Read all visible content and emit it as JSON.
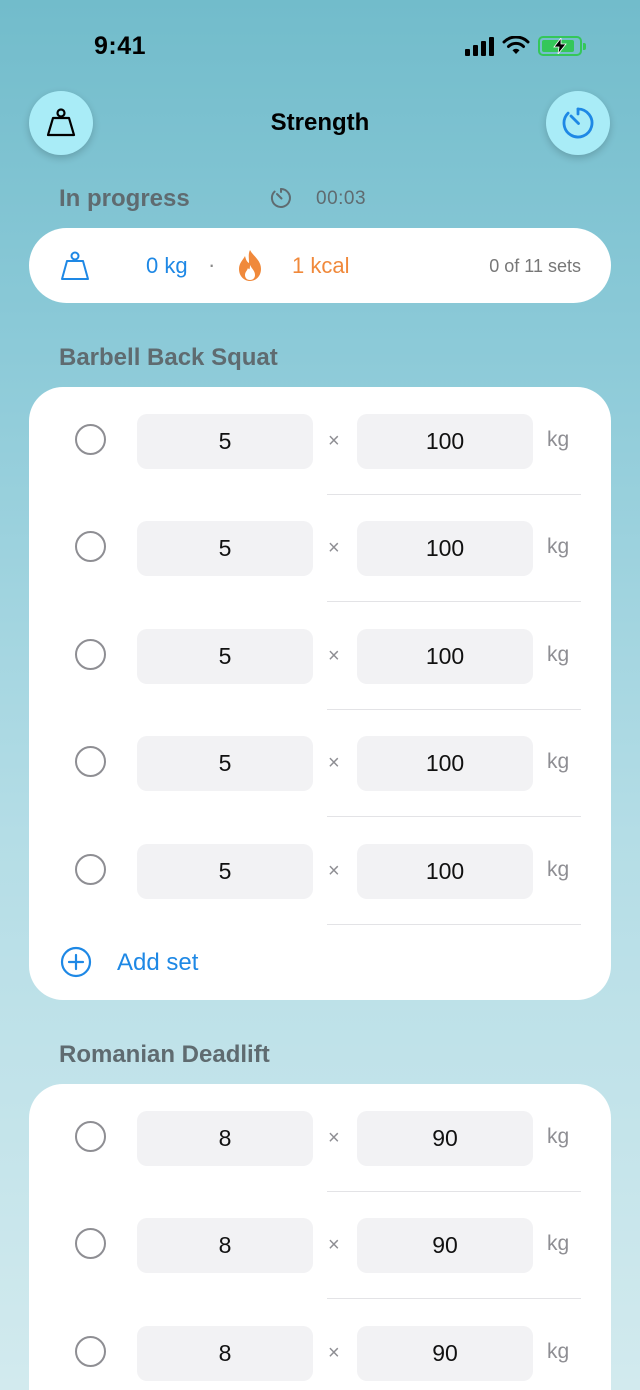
{
  "status_bar": {
    "time": "9:41"
  },
  "header": {
    "title": "Strength"
  },
  "progress": {
    "label": "In progress",
    "timer": "00:03",
    "total_weight": "0 kg",
    "separator": "·",
    "calories": "1 kcal",
    "sets_summary": "0 of 11 sets"
  },
  "exercises": [
    {
      "name": "Barbell Back Squat",
      "add_set_label": "Add set",
      "sets": [
        {
          "reps": "5",
          "times": "×",
          "weight": "100",
          "unit": "kg"
        },
        {
          "reps": "5",
          "times": "×",
          "weight": "100",
          "unit": "kg"
        },
        {
          "reps": "5",
          "times": "×",
          "weight": "100",
          "unit": "kg"
        },
        {
          "reps": "5",
          "times": "×",
          "weight": "100",
          "unit": "kg"
        },
        {
          "reps": "5",
          "times": "×",
          "weight": "100",
          "unit": "kg"
        }
      ]
    },
    {
      "name": "Romanian Deadlift",
      "sets": [
        {
          "reps": "8",
          "times": "×",
          "weight": "90",
          "unit": "kg"
        },
        {
          "reps": "8",
          "times": "×",
          "weight": "90",
          "unit": "kg"
        },
        {
          "reps": "8",
          "times": "×",
          "weight": "90",
          "unit": "kg"
        }
      ]
    }
  ],
  "colors": {
    "accent_blue": "#1e88e5",
    "calorie_orange": "#f0893b",
    "header_button_bg": "#a9ecf7",
    "battery_green": "#34c759"
  },
  "icons": {
    "left_header": "kettlebell-weight-icon",
    "right_header": "timer-icon",
    "progress_timer": "timer-icon",
    "summary_weight": "weight-icon",
    "summary_calories": "fire-icon",
    "add_set": "plus-circle-icon"
  }
}
